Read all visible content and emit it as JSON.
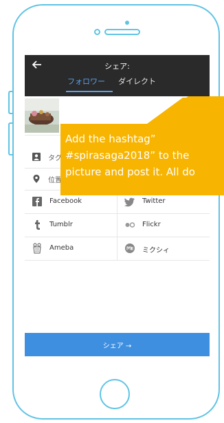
{
  "header": {
    "title": "シェア:",
    "tabs": [
      "フォロワー",
      "ダイレクト"
    ]
  },
  "rows": {
    "tag_label": "タグ",
    "location_label": "位置"
  },
  "share_options": [
    {
      "label": "Facebook",
      "icon": "facebook-icon"
    },
    {
      "label": "Twitter",
      "icon": "twitter-icon"
    },
    {
      "label": "Tumblr",
      "icon": "tumblr-icon"
    },
    {
      "label": "Flickr",
      "icon": "flickr-icon"
    },
    {
      "label": "Ameba",
      "icon": "ameba-icon"
    },
    {
      "label": "ミクシィ",
      "icon": "mixi-icon"
    }
  ],
  "share_button": "シェア →",
  "callout": {
    "line1": "Add the hashtag”",
    "line2": "#spirasaga2018” to the",
    "line3": "picture and post it. All do"
  },
  "colors": {
    "frame": "#5fc3e4",
    "header_bg": "#2a2a2a",
    "accent_blue": "#3f8fe0",
    "callout": "#f7b400"
  }
}
